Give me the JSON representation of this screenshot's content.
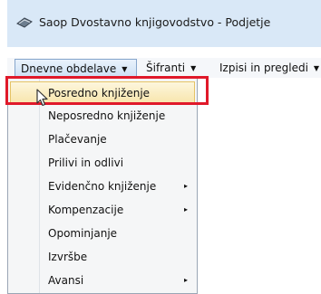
{
  "window": {
    "title": "Saop Dvostavno knjigovodstvo - Podjetje"
  },
  "menubar": {
    "items": [
      {
        "label": "Dnevne obdelave"
      },
      {
        "label": "Šifranti"
      },
      {
        "label": "Izpisi in pregledi"
      }
    ]
  },
  "dropdown": {
    "items": [
      {
        "label": "Posredno knjiženje"
      },
      {
        "label": "Neposredno knjiženje"
      },
      {
        "label": "Plačevanje"
      },
      {
        "label": "Prilivi in odlivi"
      },
      {
        "label": "Evidenčno knjiženje",
        "submenu_arrow": "▸"
      },
      {
        "label": "Kompenzacije",
        "submenu_arrow": "▸"
      },
      {
        "label": "Opominjanje"
      },
      {
        "label": "Izvršbe"
      },
      {
        "label": "Avansi",
        "submenu_arrow": "▸"
      }
    ]
  },
  "icons": {
    "app": "app-icon",
    "caret": "caret-down-icon",
    "submenu": "chevron-right-icon",
    "cursor": "mouse-pointer-icon"
  },
  "colors": {
    "highlight": "#f8e6ae",
    "callout": "#e0192a",
    "titlebar": "#d9e8f7"
  }
}
